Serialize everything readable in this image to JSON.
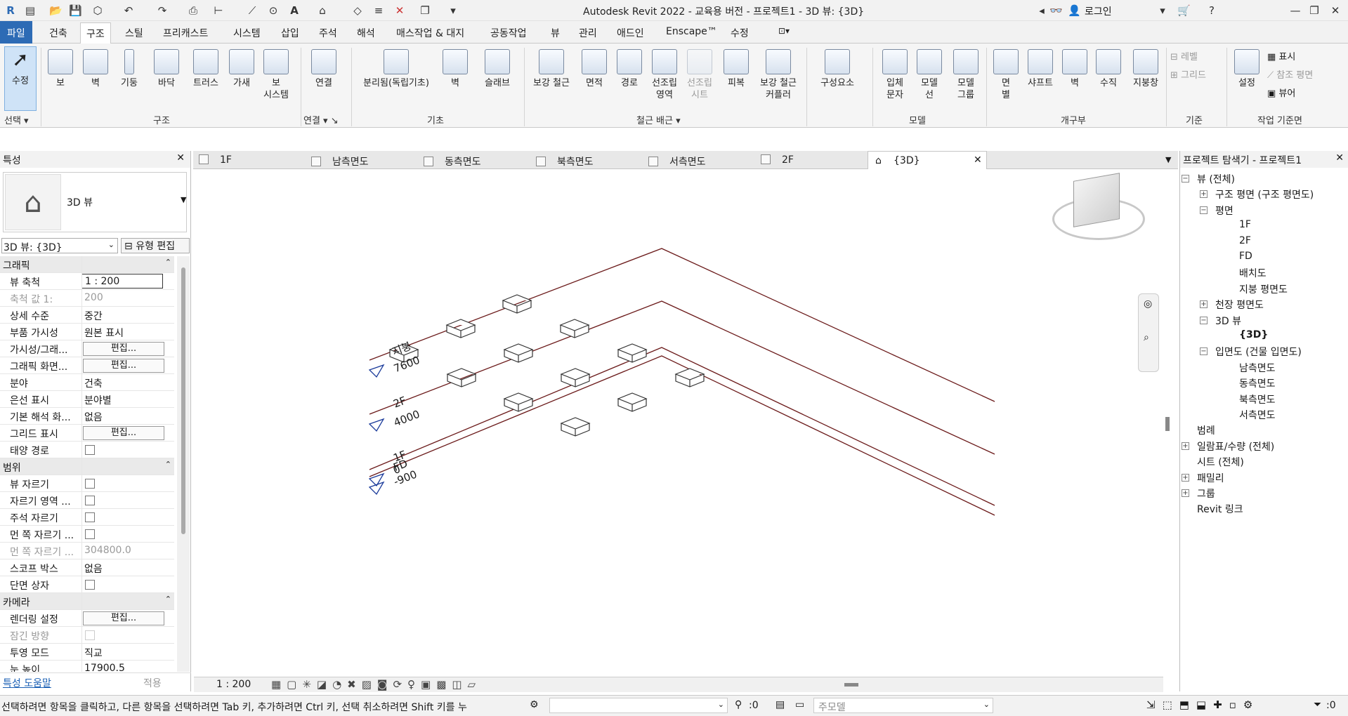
{
  "title": "Autodesk Revit 2022 - 교육용 버전 - 프로젝트1 - 3D 뷰: {3D}",
  "login": "로그인",
  "menu": [
    "파일",
    "건축",
    "구조",
    "스틸",
    "프리캐스트",
    "시스템",
    "삽입",
    "주석",
    "해석",
    "매스작업 & 대지",
    "공동작업",
    "뷰",
    "관리",
    "애드인",
    "Enscape™",
    "수정"
  ],
  "ribbon": {
    "buttons": [
      "수정",
      "보",
      "벽",
      "기둥",
      "바닥",
      "트러스",
      "가새",
      "보\n시스템",
      "연결",
      "분리됨(독립기초)",
      "벽",
      "슬래브",
      "보강 철근",
      "면적",
      "경로",
      "선조립\n영역",
      "선조립\n시트",
      "피복",
      "보강 철근\n커플러",
      "구성요소",
      "입체\n문자",
      "모델\n선",
      "모델\n그룹",
      "면\n별",
      "샤프트",
      "벽",
      "수직",
      "지붕창",
      "레벨",
      "그리드",
      "설정",
      "표시",
      "참조 평면",
      "뷰어"
    ],
    "groups": [
      "선택",
      "구조",
      "연결",
      "기초",
      "철근 배근",
      "모델",
      "개구부",
      "기준",
      "작업 기준면"
    ]
  },
  "props": {
    "title": "특성",
    "type_name": "3D 뷰",
    "selector": "3D 뷰: {3D}",
    "edit_type": "유형 편집",
    "rows": [
      {
        "k": "그래픽",
        "sec": true
      },
      {
        "k": "뷰 축척",
        "v": "1 : 200",
        "input": true
      },
      {
        "k": "축척 값    1:",
        "v": "200",
        "gray": true
      },
      {
        "k": "상세 수준",
        "v": "중간"
      },
      {
        "k": "부품 가시성",
        "v": "원본 표시"
      },
      {
        "k": "가시성/그래...",
        "btn": "편집..."
      },
      {
        "k": "그래픽 화면...",
        "btn": "편집..."
      },
      {
        "k": "분야",
        "v": "건축"
      },
      {
        "k": "은선 표시",
        "v": "분야별"
      },
      {
        "k": "기본 해석 화...",
        "v": "없음"
      },
      {
        "k": "그리드 표시",
        "btn": "편집..."
      },
      {
        "k": "태양 경로",
        "chk": true
      },
      {
        "k": "범위",
        "sec": true
      },
      {
        "k": "뷰 자르기",
        "chk": true
      },
      {
        "k": "자르기 영역 ...",
        "chk": true
      },
      {
        "k": "주석 자르기",
        "chk": true
      },
      {
        "k": "먼 쪽 자르기 ...",
        "chk": true
      },
      {
        "k": "먼 쪽 자르기 ...",
        "v": "304800.0",
        "gray": true
      },
      {
        "k": "스코프 박스",
        "v": "없음"
      },
      {
        "k": "단면 상자",
        "chk": true
      },
      {
        "k": "카메라",
        "sec": true
      },
      {
        "k": "렌더링 설정",
        "btn": "편집..."
      },
      {
        "k": "잠긴 방향",
        "chk": true,
        "gray": true
      },
      {
        "k": "투영 모드",
        "v": "직교"
      },
      {
        "k": "눈 높이",
        "v": "17900.5"
      }
    ],
    "help": "특성 도움말",
    "apply": "적용"
  },
  "tabs": [
    "1F",
    "남측면도",
    "동측면도",
    "북측면도",
    "서측면도",
    "2F",
    "{3D}"
  ],
  "levels": [
    {
      "name": "지붕",
      "elev": "7600"
    },
    {
      "name": "2F",
      "elev": "4000"
    },
    {
      "name": "1F",
      "elev": "0"
    },
    {
      "name": "FD",
      "elev": "-900"
    }
  ],
  "scale": "1 : 200",
  "browser": {
    "title": "프로젝트 탐색기 - 프로젝트1",
    "nodes": [
      {
        "t": "뷰 (전체)",
        "x": 24,
        "exp": "-"
      },
      {
        "t": "구조 평면 (구조 평면도)",
        "x": 50,
        "exp": "+"
      },
      {
        "t": "평면",
        "x": 50,
        "exp": "-"
      },
      {
        "t": "1F",
        "x": 84
      },
      {
        "t": "2F",
        "x": 84
      },
      {
        "t": "FD",
        "x": 84
      },
      {
        "t": "배치도",
        "x": 84
      },
      {
        "t": "지붕 평면도",
        "x": 84
      },
      {
        "t": "천장 평면도",
        "x": 50,
        "exp": "+"
      },
      {
        "t": "3D 뷰",
        "x": 50,
        "exp": "-"
      },
      {
        "t": "{3D}",
        "x": 84,
        "bold": true
      },
      {
        "t": "입면도 (건물 입면도)",
        "x": 50,
        "exp": "-"
      },
      {
        "t": "남측면도",
        "x": 84
      },
      {
        "t": "동측면도",
        "x": 84
      },
      {
        "t": "북측면도",
        "x": 84
      },
      {
        "t": "서측면도",
        "x": 84
      },
      {
        "t": "범례",
        "x": 24
      },
      {
        "t": "일람표/수량 (전체)",
        "x": 24,
        "exp": "+"
      },
      {
        "t": "시트 (전체)",
        "x": 24
      },
      {
        "t": "패밀리",
        "x": 24,
        "exp": "+"
      },
      {
        "t": "그룹",
        "x": 24,
        "exp": "+"
      },
      {
        "t": "Revit 링크",
        "x": 24
      }
    ]
  },
  "status": {
    "hint": "선택하려면 항목을 클릭하고, 다른 항목을 선택하려면 Tab 키, 추가하려면 Ctrl 키, 선택 취소하려면 Shift 키를 누",
    "zero1": ":0",
    "model": "주모델",
    "zero2": ":0"
  }
}
